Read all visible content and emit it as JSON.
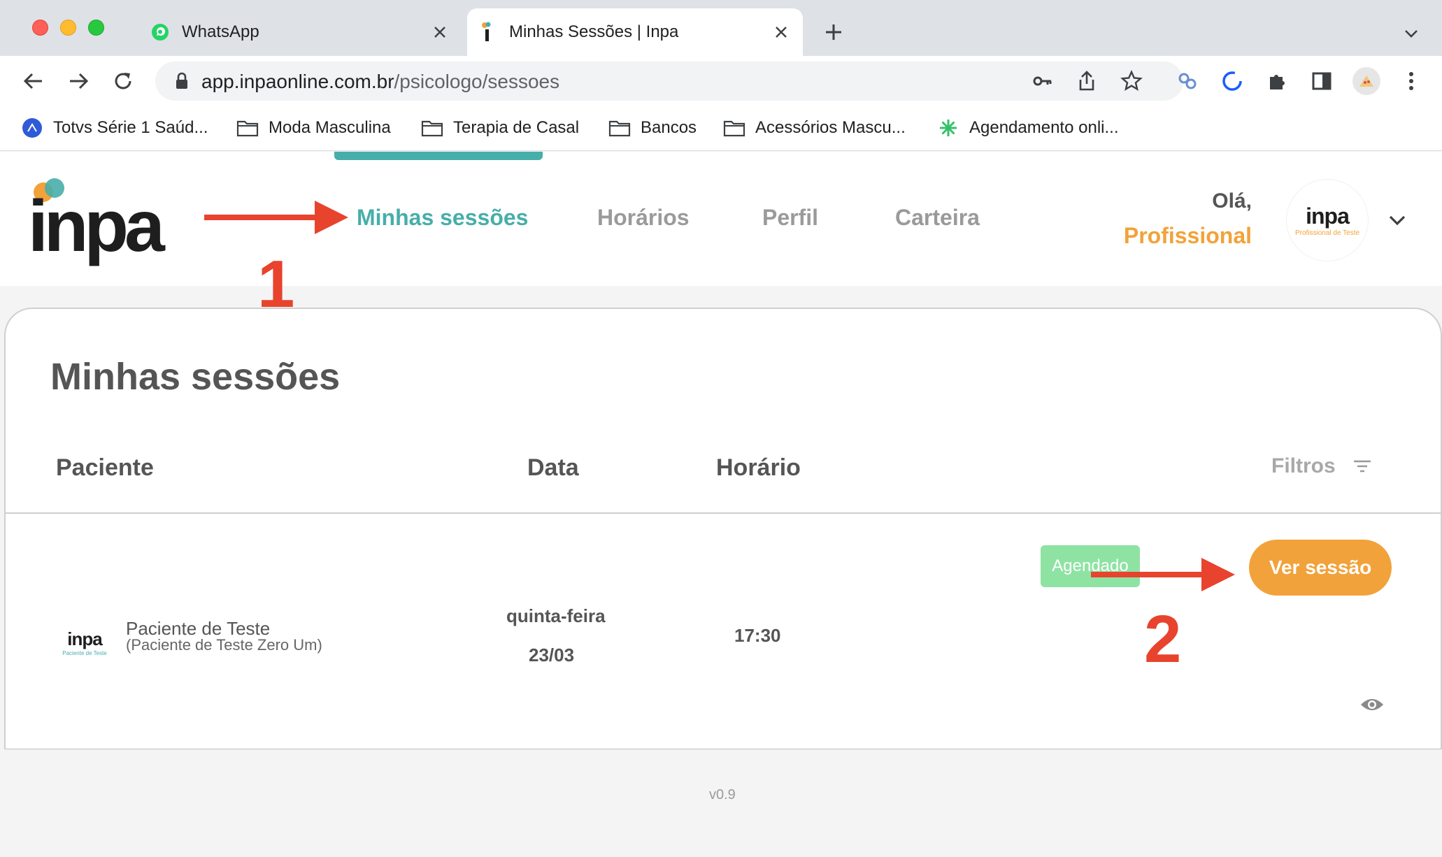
{
  "browser": {
    "tabs": [
      {
        "title": "WhatsApp",
        "icon": "whatsapp-icon",
        "active": false
      },
      {
        "title": "Minhas Sessões | Inpa",
        "icon": "inpa-favicon",
        "active": true
      }
    ],
    "url_host": "app.inpaonline.com.br",
    "url_path": "/psicologo/sessoes",
    "bookmarks": [
      {
        "label": "Totvs Série 1 Saúd...",
        "icon": "totvs-icon"
      },
      {
        "label": "Moda Masculina",
        "icon": "folder-icon"
      },
      {
        "label": "Terapia de Casal",
        "icon": "folder-icon"
      },
      {
        "label": "Bancos",
        "icon": "folder-icon"
      },
      {
        "label": "Acessórios Mascu...",
        "icon": "folder-icon"
      },
      {
        "label": "Agendamento onli...",
        "icon": "asterisk-icon"
      }
    ]
  },
  "header": {
    "logo": "inpa",
    "nav": [
      "Minhas sessões",
      "Horários",
      "Perfil",
      "Carteira"
    ],
    "active_nav": "Minhas sessões",
    "greeting": "Olá,",
    "user_role": "Profissional",
    "avatar_word": "inpa",
    "avatar_sub": "Profissional de Teste"
  },
  "main": {
    "title": "Minhas sessões",
    "columns": {
      "patient": "Paciente",
      "date": "Data",
      "time": "Horário"
    },
    "filters_label": "Filtros",
    "sessions": [
      {
        "avatar_word": "inpa",
        "avatar_sub": "Paciente de Teste",
        "patient_name": "Paciente de Teste",
        "patient_full": "(Paciente de Teste Zero Um)",
        "day": "quinta-feira",
        "date": "23/03",
        "time": "17:30",
        "status": "Agendado",
        "action": "Ver sessão"
      }
    ]
  },
  "footer": {
    "version": "v0.9"
  },
  "annotations": {
    "step1": "1",
    "step2": "2"
  },
  "colors": {
    "teal": "#47aeaa",
    "orange": "#f2a23a",
    "status_green": "#8ee3a3",
    "annotation_red": "#e8432d"
  }
}
